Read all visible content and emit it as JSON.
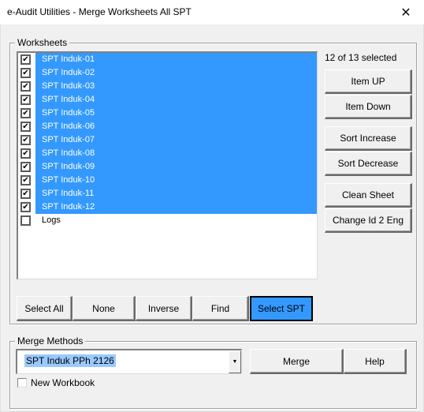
{
  "window": {
    "title": "e-Audit Utilities - Merge Worksheets All SPT",
    "close_icon": "close-icon"
  },
  "worksheets": {
    "legend": "Worksheets",
    "items": [
      {
        "label": "SPT Induk-01",
        "checked": true,
        "selected": true
      },
      {
        "label": "SPT Induk-02",
        "checked": true,
        "selected": true
      },
      {
        "label": "SPT Induk-03",
        "checked": true,
        "selected": true
      },
      {
        "label": "SPT Induk-04",
        "checked": true,
        "selected": true
      },
      {
        "label": "SPT Induk-05",
        "checked": true,
        "selected": true
      },
      {
        "label": "SPT Induk-06",
        "checked": true,
        "selected": true
      },
      {
        "label": "SPT Induk-07",
        "checked": true,
        "selected": true
      },
      {
        "label": "SPT Induk-08",
        "checked": true,
        "selected": true
      },
      {
        "label": "SPT Induk-09",
        "checked": true,
        "selected": true
      },
      {
        "label": "SPT Induk-10",
        "checked": true,
        "selected": true
      },
      {
        "label": "SPT Induk-11",
        "checked": true,
        "selected": true
      },
      {
        "label": "SPT Induk-12",
        "checked": true,
        "selected": true
      },
      {
        "label": "Logs",
        "checked": false,
        "selected": false
      }
    ],
    "selection_count": "12 of 13 selected",
    "side_buttons": {
      "item_up": "Item UP",
      "item_down": "Item Down",
      "sort_increase": "Sort Increase",
      "sort_decrease": "Sort Decrease",
      "clean_sheet": "Clean Sheet",
      "change_id_eng": "Change Id 2 Eng"
    },
    "bottom_buttons": {
      "select_all": "Select All",
      "none": "None",
      "inverse": "Inverse",
      "find": "Find",
      "select_spt": "Select SPT"
    }
  },
  "merge_methods": {
    "legend": "Merge Methods",
    "selected_method": "SPT Induk PPh 2126",
    "merge_button": "Merge",
    "help_button": "Help",
    "new_workbook_label": "New Workbook",
    "new_workbook_checked": false
  },
  "colors": {
    "selection": "#3399ff",
    "dialog_bg": "#f0f0f0"
  }
}
